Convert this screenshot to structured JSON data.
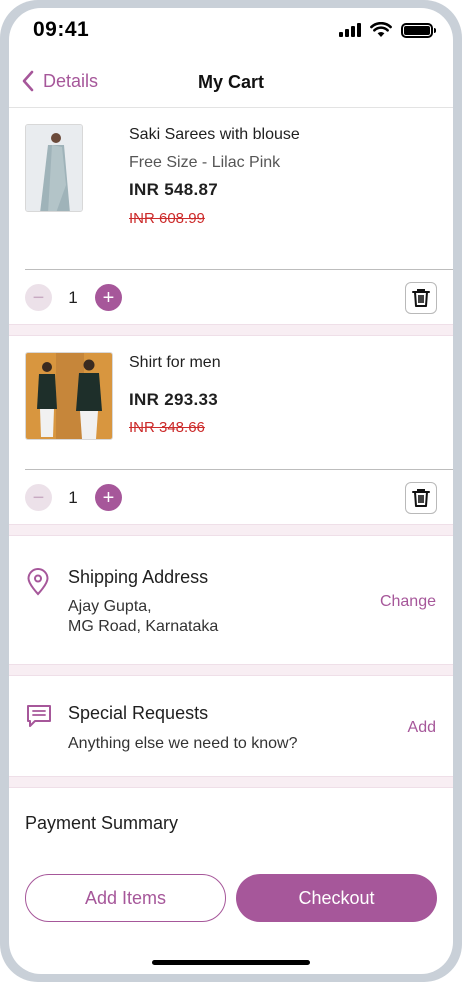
{
  "status_bar": {
    "time": "09:41",
    "signal_icon": "cellular-signal-icon",
    "wifi_icon": "wifi-icon",
    "battery_icon": "battery-icon"
  },
  "nav": {
    "back_label": "Details",
    "title": "My Cart"
  },
  "cart": {
    "items": [
      {
        "name": "Saki Sarees with blouse",
        "variant": "Free Size - Lilac Pink",
        "price": "INR 548.87",
        "old_price": "INR 608.99",
        "quantity": "1",
        "minus": "−",
        "plus": "+"
      },
      {
        "name": "Shirt for men",
        "variant": "",
        "price": "INR 293.33",
        "old_price": "INR 348.66",
        "quantity": "1",
        "minus": "−",
        "plus": "+"
      }
    ]
  },
  "shipping": {
    "title": "Shipping Address",
    "line1": "Ajay Gupta,",
    "line2": "MG Road, Karnataka",
    "action": "Change",
    "icon": "location-pin-icon"
  },
  "special_requests": {
    "title": "Special Requests",
    "line1": "Anything else we need to know?",
    "action": "Add",
    "icon": "chat-message-icon"
  },
  "payment": {
    "title": "Payment Summary"
  },
  "actions": {
    "add_items": "Add Items",
    "checkout": "Checkout"
  },
  "colors": {
    "accent": "#a6579a",
    "strike_price": "#cc2b2b",
    "separator": "#f8eef3"
  }
}
